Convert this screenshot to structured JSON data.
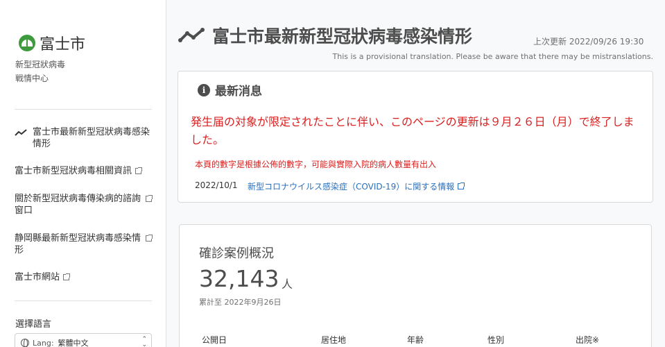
{
  "sidebar": {
    "logo_text": "富士市",
    "subtitle_line1": "新型冠狀病毒",
    "subtitle_line2": "戦情中心",
    "nav_items": [
      {
        "label": "富士市最新新型冠狀病毒感染情形",
        "icon": "trend-icon"
      },
      {
        "label": "富士市新型冠狀病毒相關資訊",
        "icon": "external-link-icon"
      },
      {
        "label": "關於新型冠狀病毒傳染病的諮詢窗口",
        "icon": "external-link-icon"
      },
      {
        "label": "静岡縣最新新型冠狀病毒感染情形",
        "icon": "external-link-icon"
      },
      {
        "label": "富士市網站",
        "icon": "external-link-icon"
      }
    ],
    "lang_title": "選擇語言",
    "lang_label": "Lang:",
    "lang_value": "繁體中文"
  },
  "header": {
    "title": "富士市最新新型冠狀病毒感染情形",
    "last_update": "上次更新 2022/09/26 19:30",
    "translation_note": "This is a provisional translation. Please be aware that there may be mistranslations."
  },
  "news": {
    "title": "最新消息",
    "notice": "発生届の対象が限定されたことに伴い、このページの更新は９月２６日（月）で終了しました。",
    "notice_small": "本頁的數字是根據公佈的數字，可能與實際入院的病人數量有出入",
    "item_date": "2022/10/1",
    "item_link": "新型コロナウイルス感染症（COVID-19）に関する情報"
  },
  "cases": {
    "title": "確診案例概況",
    "count": "32,143",
    "unit": "人",
    "note": "累計至 2022年9月26日",
    "columns": [
      "公開日",
      "居住地",
      "年齢",
      "性別",
      "出院※"
    ]
  },
  "colors": {
    "accent_red": "#d92020",
    "link_blue": "#2a6fbd",
    "logo_green": "#3d9a3d"
  }
}
